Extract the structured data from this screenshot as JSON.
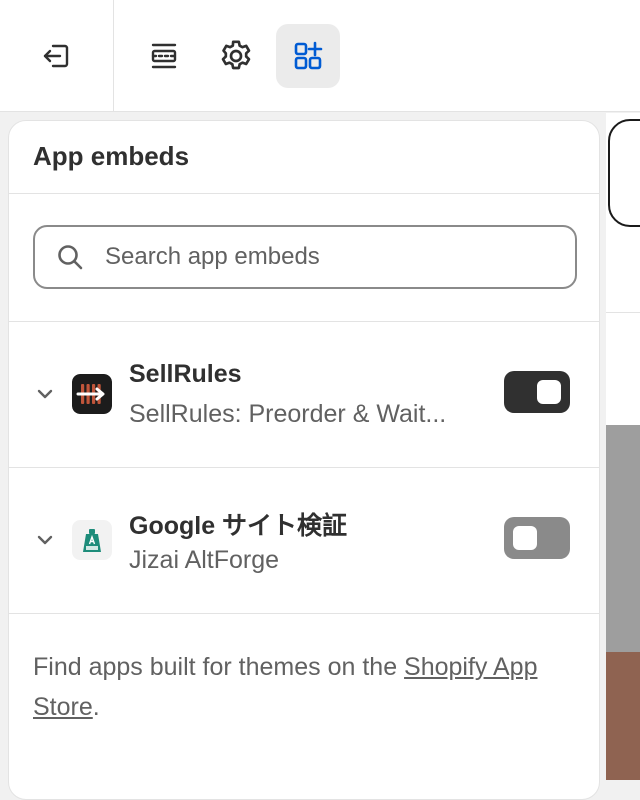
{
  "toolbar": {
    "items": [
      {
        "icon": "exit-icon",
        "active": false
      },
      {
        "icon": "sections-icon",
        "active": false
      },
      {
        "icon": "gear-icon",
        "active": false
      },
      {
        "icon": "apps-add-icon",
        "active": true
      }
    ]
  },
  "panel": {
    "title": "App embeds",
    "search": {
      "placeholder": "Search app embeds",
      "value": ""
    },
    "embeds": [
      {
        "name": "SellRules",
        "subtitle": "SellRules: Preorder & Wait...",
        "enabled": true,
        "icon": "sellrules-app-icon"
      },
      {
        "name": "Google サイト検証",
        "subtitle": "Jizai AltForge",
        "enabled": false,
        "icon": "jizai-app-icon"
      }
    ],
    "footer": {
      "text_before": "Find apps built for themes on the ",
      "link_text": "Shopify App Store",
      "text_after": "."
    }
  },
  "colors": {
    "text": "#303030",
    "subdued": "#616161",
    "toggle_on": "#303030",
    "toggle_off": "#8a8a8a",
    "active_bg": "#ebebeb",
    "accent_icon": "#005bd3"
  }
}
